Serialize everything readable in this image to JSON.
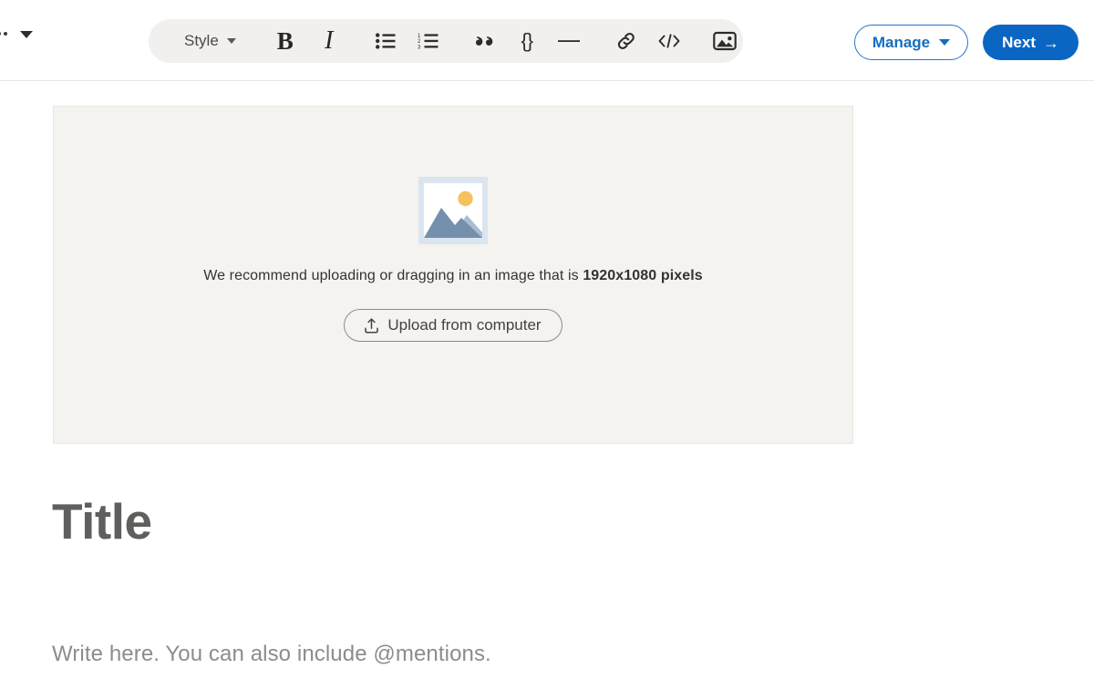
{
  "toolbar": {
    "overflow_menu_label": "…",
    "style_label": "Style",
    "items": [
      {
        "name": "bold-icon",
        "label": "B"
      },
      {
        "name": "italic-icon",
        "label": "I"
      },
      {
        "name": "bulleted-list-icon",
        "label": "Bulleted list"
      },
      {
        "name": "numbered-list-icon",
        "label": "Numbered list"
      },
      {
        "name": "quote-icon",
        "label": "Quote"
      },
      {
        "name": "code-block-icon",
        "label": "{}"
      },
      {
        "name": "horizontal-rule-icon",
        "label": "Horizontal rule"
      },
      {
        "name": "link-icon",
        "label": "Link"
      },
      {
        "name": "embed-code-icon",
        "label": "</>"
      },
      {
        "name": "image-icon",
        "label": "Image"
      }
    ],
    "manage_label": "Manage",
    "next_label": "Next",
    "next_arrow": "→"
  },
  "cover": {
    "recommend_prefix": "We recommend uploading or dragging in an image that is",
    "recommend_dimensions": "1920x1080 pixels",
    "upload_label": "Upload from computer",
    "upload_icon": "upload-tray-icon"
  },
  "editor": {
    "title_placeholder": "Title",
    "body_placeholder": "Write here. You can also include @mentions."
  },
  "colors": {
    "brand_blue": "#0a66c2",
    "manage_blue": "#156dbe",
    "toolbar_pill": "#f1f0ee",
    "dropzone_bg": "#f4f3f0",
    "dropzone_border": "#e9e7e3",
    "title_gray": "#5f5f5d",
    "body_gray": "#8e8c88",
    "icon_frame": "#dbe5f0",
    "icon_mountain": "#7590ad",
    "icon_hill": "#a8bdd4",
    "icon_sun": "#f5c25c"
  }
}
